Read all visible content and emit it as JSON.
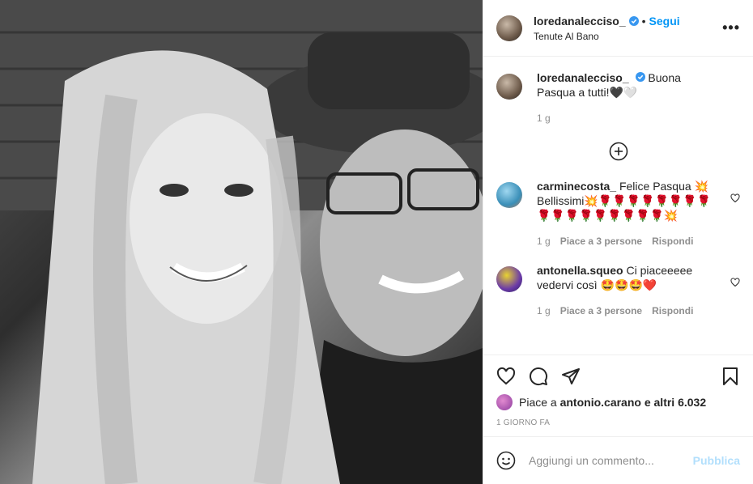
{
  "photo": {
    "alt": ""
  },
  "header": {
    "username": "loredanalecciso_",
    "separator": "•",
    "follow_label": "Segui",
    "location": "Tenute Al Bano",
    "more_icon": "more-dots-icon"
  },
  "caption": {
    "username": "loredanalecciso_",
    "text": "Buona Pasqua a tutti!🖤🤍",
    "time": "1 g"
  },
  "load_more_icon": "plus-circle-icon",
  "comments": [
    {
      "username": "carminecosta_",
      "text": "Felice Pasqua 💥 Bellissimi💥🌹🌹🌹🌹🌹🌹🌹🌹🌹🌹🌹🌹🌹🌹🌹🌹🌹💥",
      "time": "1 g",
      "likes": "Piace a 3 persone",
      "reply": "Rispondi"
    },
    {
      "username": "antonella.squeo",
      "text": "Ci piaceeeee vedervi così 🤩🤩🤩❤️",
      "time": "1 g",
      "likes": "Piace a 3 persone",
      "reply": "Rispondi"
    }
  ],
  "likes": {
    "prefix": "Piace a",
    "user": "antonio.carano",
    "suffix": "e altri 6.032"
  },
  "date": "1 GIORNO FA",
  "add_comment": {
    "placeholder": "Aggiungi un commento...",
    "publish": "Pubblica"
  },
  "colors": {
    "accent": "#0095f6",
    "publish_disabled": "#b2dffc",
    "muted": "#8e8e8e"
  }
}
